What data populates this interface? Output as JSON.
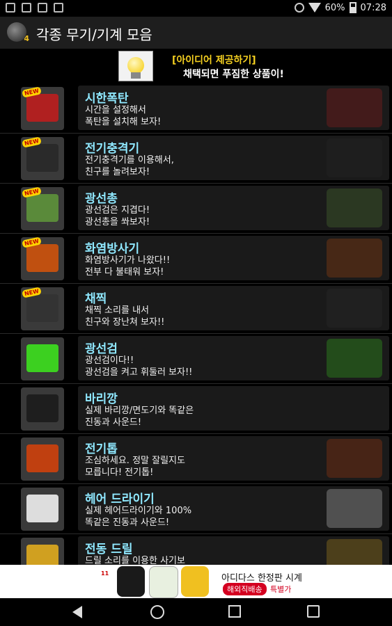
{
  "status_bar": {
    "battery": "60%",
    "time": "07:28",
    "left_icons": [
      "gallery-icon",
      "sim-icon",
      "usb-icon",
      "android-icon"
    ],
    "right_icons": [
      "mute-icon",
      "wifi-icon",
      "battery-icon"
    ]
  },
  "action_bar": {
    "app_icon_badge": "4",
    "title": "각종 무기/기계 모음"
  },
  "banner": {
    "line1": "[아이디어 제공하기]",
    "line2": "채택되면 푸짐한 상품이!",
    "icon": "lightbulb-icon"
  },
  "list": {
    "items": [
      {
        "title": "시한폭탄",
        "desc": "시간을 설정해서\n폭탄을 설치해 보자!",
        "badge": "NEW",
        "thumb_color": "#b02020"
      },
      {
        "title": "전기충격기",
        "desc": "전기충격기를 이용해서,\n친구를 놀려보자!",
        "badge": "NEW",
        "thumb_color": "#2a2a2a"
      },
      {
        "title": "광선총",
        "desc": "광선검은 지겹다!\n광선총을 쏴보자!",
        "badge": "NEW",
        "thumb_color": "#5a8a3a"
      },
      {
        "title": "화염방사기",
        "desc": "화염방사기가 나왔다!!\n전부 다 불태워 보자!",
        "badge": "NEW",
        "thumb_color": "#c05010"
      },
      {
        "title": "채찍",
        "desc": "채찍 소리를 내서\n친구와 장난쳐 보자!!",
        "badge": "NEW",
        "thumb_color": "#333333"
      },
      {
        "title": "광선검",
        "desc": "광선검이다!!\n광선검을 켜고 휘둘러 보자!!",
        "badge": "",
        "thumb_color": "#3cd020"
      },
      {
        "title": "바리깡",
        "desc": "실제 바리깡/면도기와 똑같은\n진동과 사운드!",
        "badge": "",
        "thumb_color": "#1e1e1e"
      },
      {
        "title": "전기톱",
        "desc": "조심하세요. 정말 잘릴지도\n모릅니다! 전기톱!",
        "badge": "",
        "thumb_color": "#c04010"
      },
      {
        "title": "헤어 드라이기",
        "desc": "실제 헤어드라이기와 100%\n똑같은 진동과 사운드!",
        "badge": "",
        "thumb_color": "#dddddd"
      },
      {
        "title": "전동 드릴",
        "desc": "드릴 소리를 이용한 사기보\n",
        "badge": "",
        "thumb_color": "#d0a020"
      }
    ]
  },
  "ad": {
    "title": "아디다스 한정판 시계",
    "tag": "해외직배송",
    "sub": "특별가"
  },
  "nav": {
    "icons": [
      "back-icon",
      "home-icon",
      "recents-icon",
      "screenshot-icon"
    ]
  }
}
